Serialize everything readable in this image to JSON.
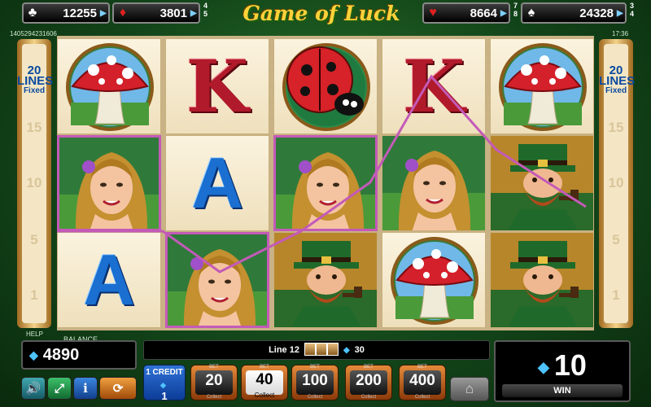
{
  "game": {
    "title": "Game of Luck"
  },
  "jackpots": [
    {
      "suit": "♣",
      "value": "12255",
      "extra": "",
      "color": "#ffffff"
    },
    {
      "suit": "♦",
      "value": "3801",
      "extra": "4\n5",
      "color": "#e02020"
    },
    {
      "suit": "♥",
      "value": "8664",
      "extra": "7\n8",
      "color": "#e02020"
    },
    {
      "suit": "♠",
      "value": "24328",
      "extra": "3\n4",
      "color": "#ffffff"
    }
  ],
  "ids": {
    "left_code": "1405294231606",
    "right_time": "17:36"
  },
  "side_panel": {
    "lines_count": "20",
    "lines_label": "LINES",
    "fixed_label": "Fixed",
    "markers": [
      "15",
      "10",
      "5",
      "1"
    ]
  },
  "reels": [
    [
      "mushroom",
      "girl",
      "A"
    ],
    [
      "K",
      "A",
      "girl"
    ],
    [
      "ladybug",
      "girl",
      "leprechaun"
    ],
    [
      "K",
      "girl",
      "mushroom"
    ],
    [
      "mushroom",
      "leprechaun",
      "leprechaun"
    ]
  ],
  "win_highlight_positions": [
    "0-1",
    "1-2",
    "2-1"
  ],
  "bottom": {
    "help_label": "HELP",
    "balance_label": "BALANCE",
    "balance_value": "4890",
    "line_win_text": "Line 12",
    "line_win_amount": "30",
    "win_value": "10",
    "win_label": "WIN",
    "credit_label": "1 CREDIT",
    "credit_value": "1",
    "bet_label": "BET",
    "bets": [
      {
        "value": "20",
        "sub": "Collect",
        "active": false
      },
      {
        "value": "40",
        "sub": "Collect",
        "active": true
      },
      {
        "value": "100",
        "sub": "Collect",
        "active": false
      },
      {
        "value": "200",
        "sub": "Collect",
        "active": false
      },
      {
        "value": "400",
        "sub": "Collect",
        "active": false
      }
    ]
  },
  "icons": {
    "sound": "speaker-icon",
    "fullscreen": "fullscreen-icon",
    "info": "info-icon",
    "autoplay": "autoplay-icon",
    "home": "home-icon"
  }
}
